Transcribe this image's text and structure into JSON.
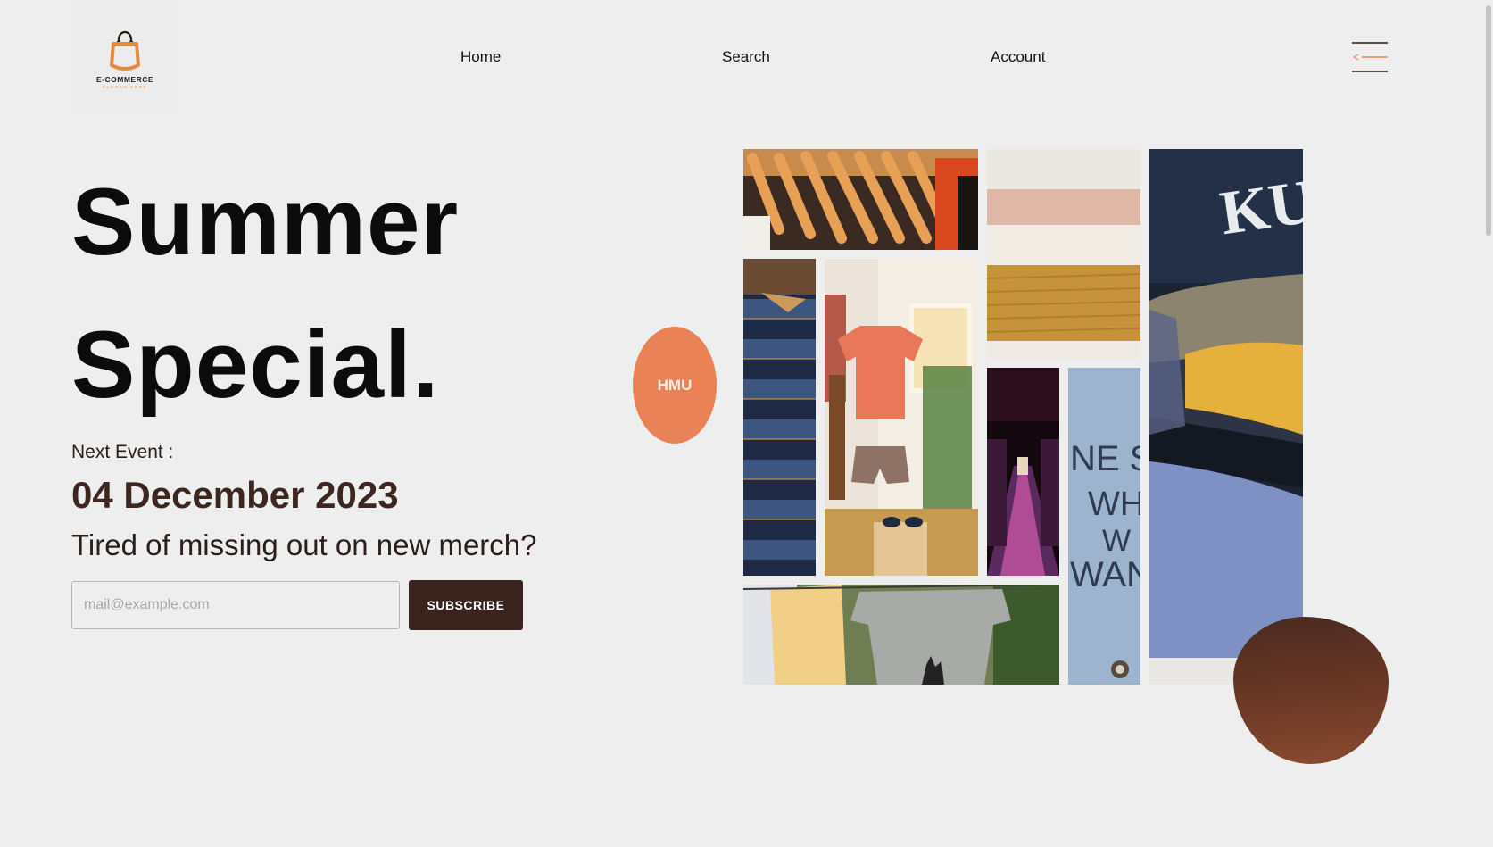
{
  "header": {
    "logo": {
      "title": "E-COMMERCE",
      "slogan": "SLOGAN HERE",
      "icon": "shopping-bag-icon",
      "accent": "#e58a3c"
    },
    "nav": [
      {
        "label": "Home"
      },
      {
        "label": "Search"
      },
      {
        "label": "Account"
      }
    ],
    "menu_icon": "hamburger-menu-icon"
  },
  "hero": {
    "title_line1": "Summer",
    "title_line2": "Special.",
    "next_event_label": "Next Event :",
    "event_date": "04 December 2023",
    "tagline": "Tired of missing out on new merch?",
    "email_placeholder": "mail@example.com",
    "subscribe_label": "SUBSCRIBE"
  },
  "badge": {
    "label": "HMU",
    "color": "#e98357"
  },
  "collage": {
    "photos": [
      "hangers",
      "knit-sweaters",
      "jacket-stack",
      "denim-folded",
      "hanging-tshirt-room",
      "store-aisle",
      "denim-jacket-text",
      "shirts-on-line"
    ]
  },
  "colors": {
    "background": "#efeeee",
    "brand_dark": "#3a231c",
    "brand_orange": "#e98357"
  }
}
